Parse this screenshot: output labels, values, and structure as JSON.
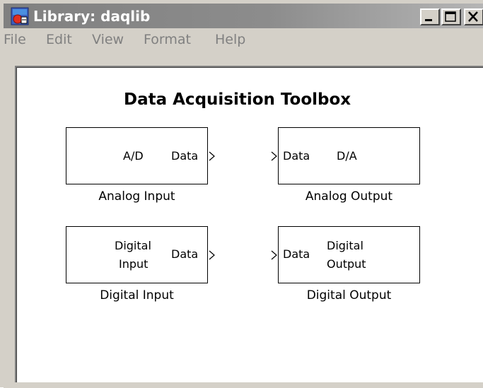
{
  "window": {
    "title": "Library: daqlib",
    "icon": "simulink-library-icon",
    "controls": [
      "minimize-icon",
      "maximize-icon",
      "close-icon"
    ]
  },
  "menu": {
    "items": [
      "File",
      "Edit",
      "View",
      "Format",
      "Help"
    ],
    "state": "disabled"
  },
  "library": {
    "title": "Data Acquisition Toolbox",
    "blocks": [
      {
        "name": "Analog Input",
        "inner_text": "A/D",
        "inport": "",
        "outport": "Data"
      },
      {
        "name": "Analog Output",
        "inner_text": "D/A",
        "inport": "Data",
        "outport": ""
      },
      {
        "name": "Digital Input",
        "inner_text_line1": "Digital",
        "inner_text_line2": "Input",
        "inport": "",
        "outport": "Data"
      },
      {
        "name": "Digital Output",
        "inner_text_line1": "Digital",
        "inner_text_line2": "Output",
        "inport": "Data",
        "outport": ""
      }
    ]
  },
  "colors": {
    "titlebar_inactive": "#808080",
    "face": "#d4d0c8",
    "canvas": "#ffffff",
    "menu_text_disabled": "#808080"
  }
}
